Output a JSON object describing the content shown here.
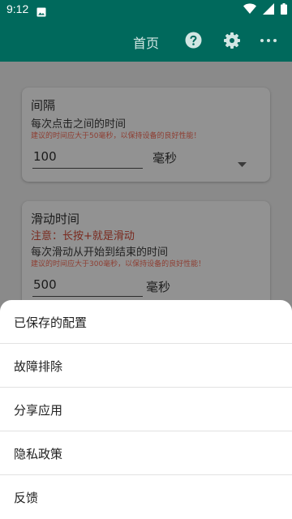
{
  "status_bar": {
    "time": "9:12",
    "icons": [
      "image-icon",
      "wifi-icon",
      "signal-icon",
      "battery-icon"
    ]
  },
  "app_bar": {
    "home_label": "首页",
    "icons": [
      "help-icon",
      "gear-icon",
      "more-icon"
    ]
  },
  "cards": {
    "interval": {
      "title": "间隔",
      "description": "每次点击之间的时间",
      "hint": "建议的时间应大于50毫秒，以保持设备的良好性能！",
      "value": "100",
      "unit": "毫秒"
    },
    "swipe": {
      "title": "滑动时间",
      "warning": "注意：长按+就是滑动",
      "description": "每次滑动从开始到结束的时间",
      "hint": "建议的时间应大于300毫秒，以保持设备的良好性能！",
      "value": "500",
      "unit": "毫秒"
    }
  },
  "bottom_sheet": {
    "items": [
      {
        "label": "已保存的配置"
      },
      {
        "label": "故障排除"
      },
      {
        "label": "分享应用"
      },
      {
        "label": "隐私政策"
      },
      {
        "label": "反馈"
      }
    ]
  },
  "colors": {
    "primary": "#00695c",
    "scrim": "#858585",
    "sheet": "#ffffff",
    "warning": "#7a2a1f"
  }
}
